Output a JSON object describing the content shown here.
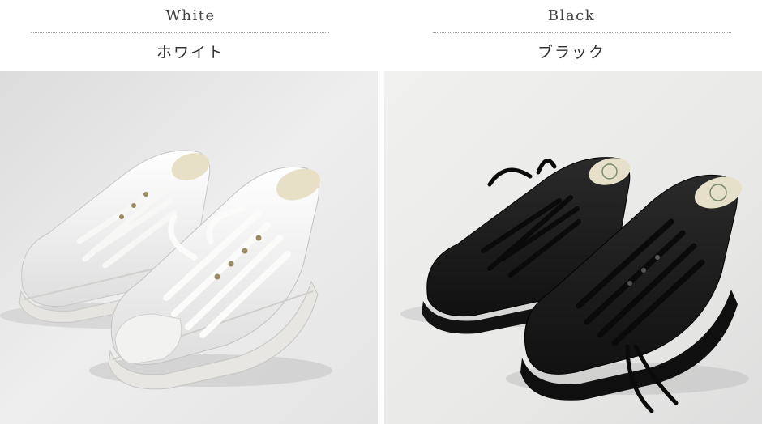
{
  "variants": [
    {
      "name_en": "White",
      "name_ja": "ホワイト",
      "color": "#f2f2f0",
      "sole": "#eceae6",
      "lace": "#f7f7f5",
      "insole": "#e8dfc7"
    },
    {
      "name_en": "Black",
      "name_ja": "ブラック",
      "color": "#1a1a1a",
      "sole": "#121212",
      "lace": "#0d0d0d",
      "insole": "#e6dfc9"
    }
  ],
  "colors": {
    "background": "#ffffff",
    "photo_bg": "#e9e9e7",
    "separator": "#9a9a9a"
  }
}
